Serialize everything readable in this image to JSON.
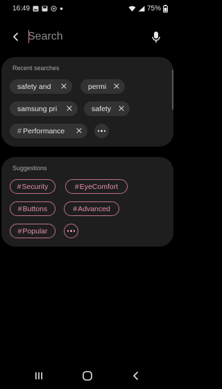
{
  "status_bar": {
    "time": "16:49",
    "battery": "75%",
    "icons": [
      "gallery-icon",
      "save-icon",
      "settings-icon",
      "notification-dot-icon",
      "wifi-icon",
      "signal-icon",
      "battery-icon"
    ]
  },
  "search": {
    "placeholder": "Search",
    "value": ""
  },
  "recent": {
    "title": "Recent searches",
    "items": [
      {
        "label": "safety and"
      },
      {
        "label": "permi"
      },
      {
        "label": "samsung pri"
      },
      {
        "label": "safety"
      },
      {
        "label": "Performance",
        "hash": "#"
      }
    ]
  },
  "suggestions": {
    "title": "Suggestions",
    "items": [
      {
        "hash": "#",
        "label": "Security"
      },
      {
        "hash": "#",
        "label": "EyeComfort"
      },
      {
        "hash": "#",
        "label": "Buttons"
      },
      {
        "hash": "#",
        "label": "Advanced"
      },
      {
        "hash": "#",
        "label": "Popular"
      }
    ]
  },
  "colors": {
    "background": "#000000",
    "card": "#1e1e1e",
    "chip": "#333333",
    "accent": "#e08fae",
    "accent_border": "#c2708d"
  },
  "nav_bar": {
    "icons": [
      "recent-apps-icon",
      "home-icon",
      "back-nav-icon"
    ]
  }
}
